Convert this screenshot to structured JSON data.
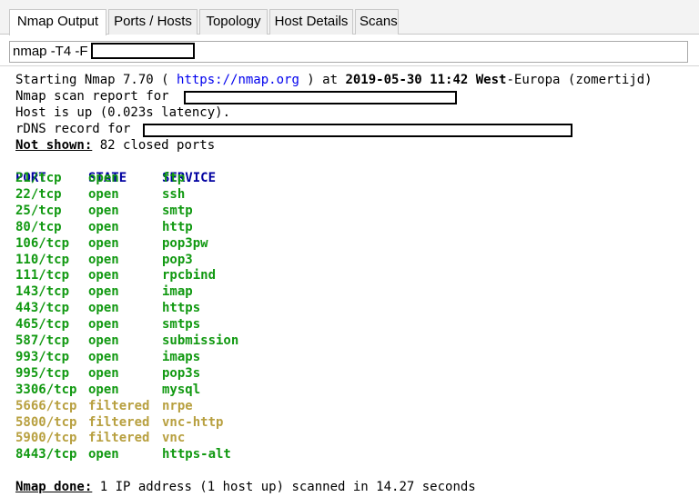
{
  "tabs": [
    {
      "label": "Nmap Output",
      "active": true
    },
    {
      "label": "Ports / Hosts",
      "active": false
    },
    {
      "label": "Topology",
      "active": false
    },
    {
      "label": "Host Details",
      "active": false
    },
    {
      "label": "Scans",
      "active": false
    }
  ],
  "command": "nmap -T4 -F",
  "output": {
    "start_prefix": "Starting Nmap 7.70 ( ",
    "start_url": "https://nmap.org",
    "start_mid": " ) at ",
    "start_time": "2019-05-30 11:42",
    "start_tz": " West",
    "start_tz2": "-Europa (zomertijd)",
    "report_for": "Nmap scan report for",
    "host_up": "Host is up (0.023s latency).",
    "rdns": "rDNS record for",
    "not_shown_label": "Not shown:",
    "not_shown_text": " 82 closed ports",
    "headers": {
      "port": "PORT",
      "state": "STATE",
      "service": "SERVICE"
    },
    "ports": [
      {
        "port": "21/tcp",
        "state": "open",
        "service": "ftp"
      },
      {
        "port": "22/tcp",
        "state": "open",
        "service": "ssh"
      },
      {
        "port": "25/tcp",
        "state": "open",
        "service": "smtp"
      },
      {
        "port": "80/tcp",
        "state": "open",
        "service": "http"
      },
      {
        "port": "106/tcp",
        "state": "open",
        "service": "pop3pw"
      },
      {
        "port": "110/tcp",
        "state": "open",
        "service": "pop3"
      },
      {
        "port": "111/tcp",
        "state": "open",
        "service": "rpcbind"
      },
      {
        "port": "143/tcp",
        "state": "open",
        "service": "imap"
      },
      {
        "port": "443/tcp",
        "state": "open",
        "service": "https"
      },
      {
        "port": "465/tcp",
        "state": "open",
        "service": "smtps"
      },
      {
        "port": "587/tcp",
        "state": "open",
        "service": "submission"
      },
      {
        "port": "993/tcp",
        "state": "open",
        "service": "imaps"
      },
      {
        "port": "995/tcp",
        "state": "open",
        "service": "pop3s"
      },
      {
        "port": "3306/tcp",
        "state": "open",
        "service": "mysql"
      },
      {
        "port": "5666/tcp",
        "state": "filtered",
        "service": "nrpe"
      },
      {
        "port": "5800/tcp",
        "state": "filtered",
        "service": "vnc-http"
      },
      {
        "port": "5900/tcp",
        "state": "filtered",
        "service": "vnc"
      },
      {
        "port": "8443/tcp",
        "state": "open",
        "service": "https-alt"
      }
    ],
    "done_label": "Nmap done:",
    "done_text": " 1 IP address (1 host up) scanned in 14.27 seconds"
  },
  "colors": {
    "open": "#119911",
    "filtered": "#b8a040",
    "header": "#0000a0",
    "link": "#0000ee"
  }
}
